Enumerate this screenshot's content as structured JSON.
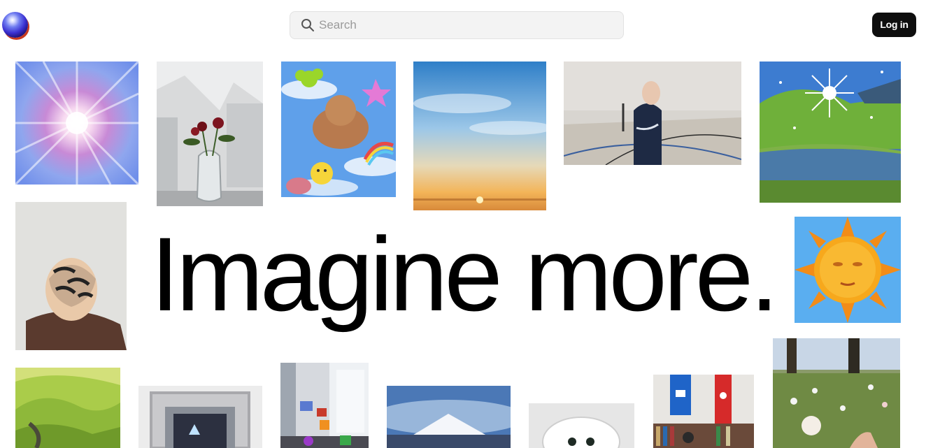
{
  "header": {
    "logo_icon": "glossy-orb-icon",
    "search": {
      "placeholder": "Search",
      "icon": "search-icon"
    },
    "login_label": "Log in"
  },
  "hero": {
    "headline": "Imagine more."
  },
  "gallery": {
    "images": [
      {
        "name": "radial-burst-image",
        "subject": "pink and blue radial light burst"
      },
      {
        "name": "rose-vase-image",
        "subject": "roses in a glass vase"
      },
      {
        "name": "sticker-collage-image",
        "subject": "puppy with cartoon stickers"
      },
      {
        "name": "sky-sunset-image",
        "subject": "blue sky over sunset"
      },
      {
        "name": "gym-person-image",
        "subject": "person in a gym hall"
      },
      {
        "name": "sparkle-lake-image",
        "subject": "sparkling sun over hills and lake"
      },
      {
        "name": "braided-hair-image",
        "subject": "back of head with patterned hair"
      },
      {
        "name": "sun-face-image",
        "subject": "orange sun face"
      },
      {
        "name": "green-hills-image",
        "subject": "green rolling hills"
      },
      {
        "name": "chrome-frame-image",
        "subject": "chrome ornate frame"
      },
      {
        "name": "window-room-image",
        "subject": "room with window and photos"
      },
      {
        "name": "mountain-image",
        "subject": "snowy mountain"
      },
      {
        "name": "fluffy-creature-image",
        "subject": "fluffy white creature"
      },
      {
        "name": "library-banners-image",
        "subject": "library with banners"
      },
      {
        "name": "wildflowers-image",
        "subject": "wildflowers in meadow"
      }
    ]
  }
}
